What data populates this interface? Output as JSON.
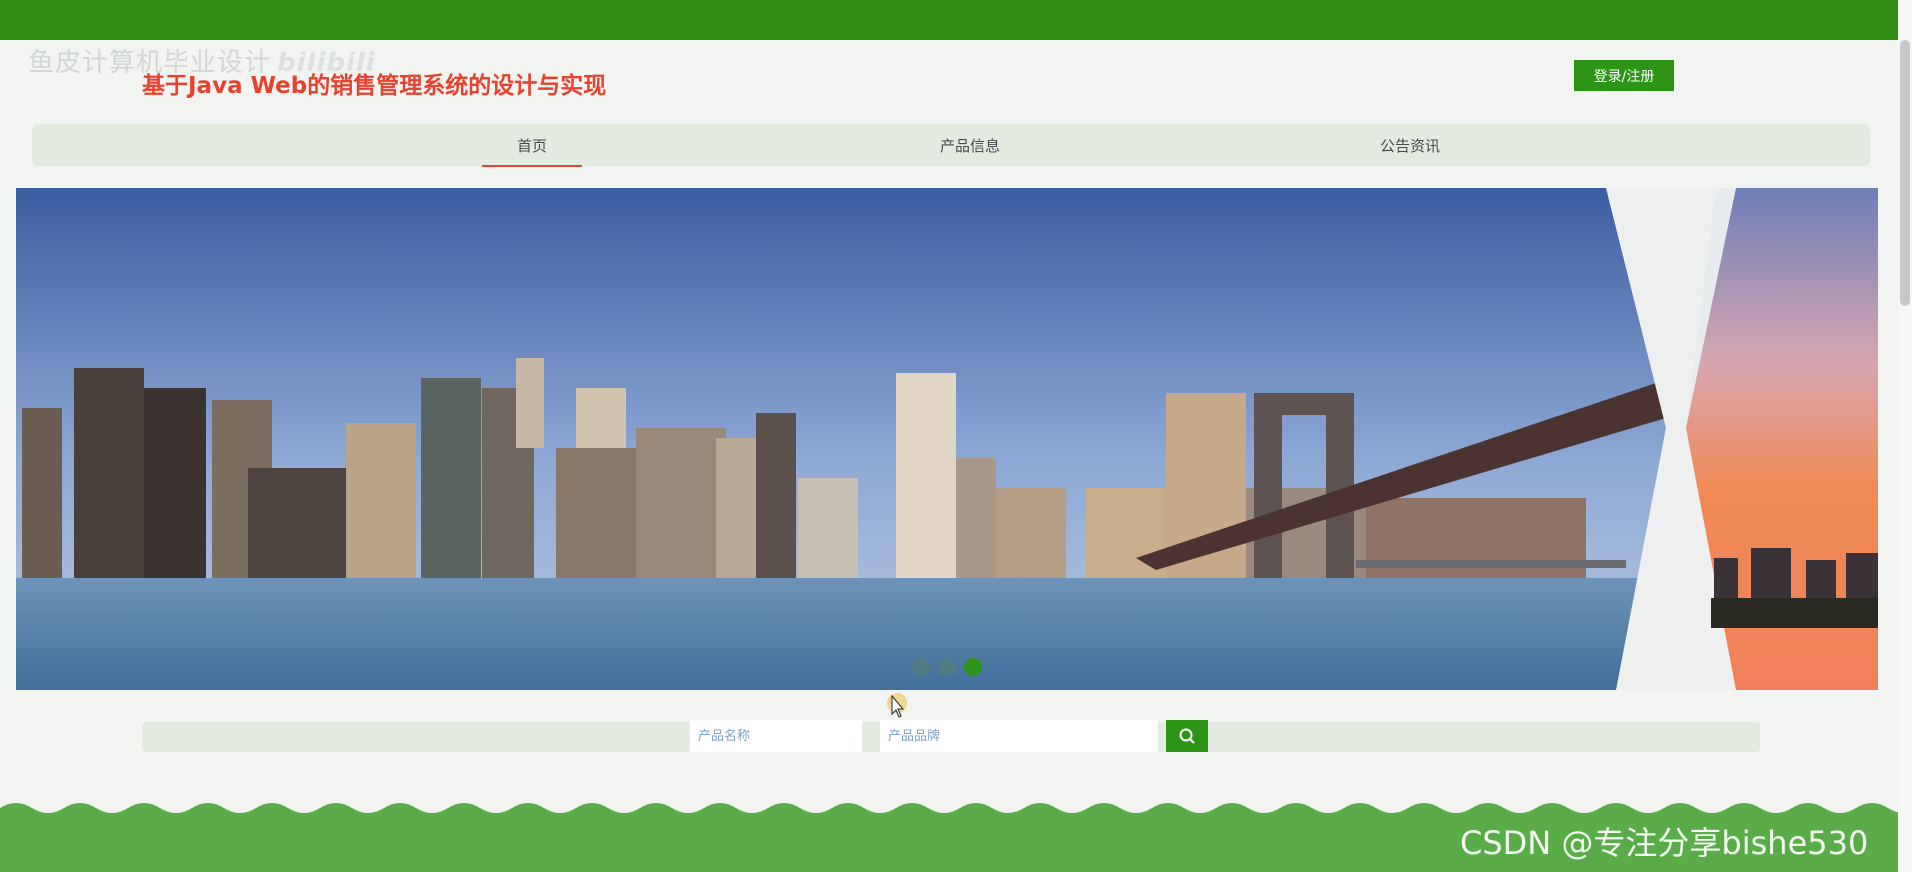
{
  "watermark_top": {
    "text": "鱼皮计算机毕业设计",
    "logo": "bilibili"
  },
  "header": {
    "title": "基于Java Web的销售管理系统的设计与实现",
    "login_label": "登录/注册"
  },
  "nav": {
    "items": [
      {
        "label": "首页",
        "active": true
      },
      {
        "label": "产品信息",
        "active": false
      },
      {
        "label": "公告资讯",
        "active": false
      }
    ]
  },
  "banner": {
    "slides": 3,
    "active_slide": 3
  },
  "search": {
    "name_placeholder": "产品名称",
    "brand_placeholder": "产品品牌",
    "button_icon": "search-icon"
  },
  "watermark_bottom": {
    "text": "CSDN @专注分享bishe530"
  },
  "colors": {
    "brand_green": "#2e9418",
    "title_red": "#e8422e",
    "nav_bg": "#e3ebe0"
  }
}
